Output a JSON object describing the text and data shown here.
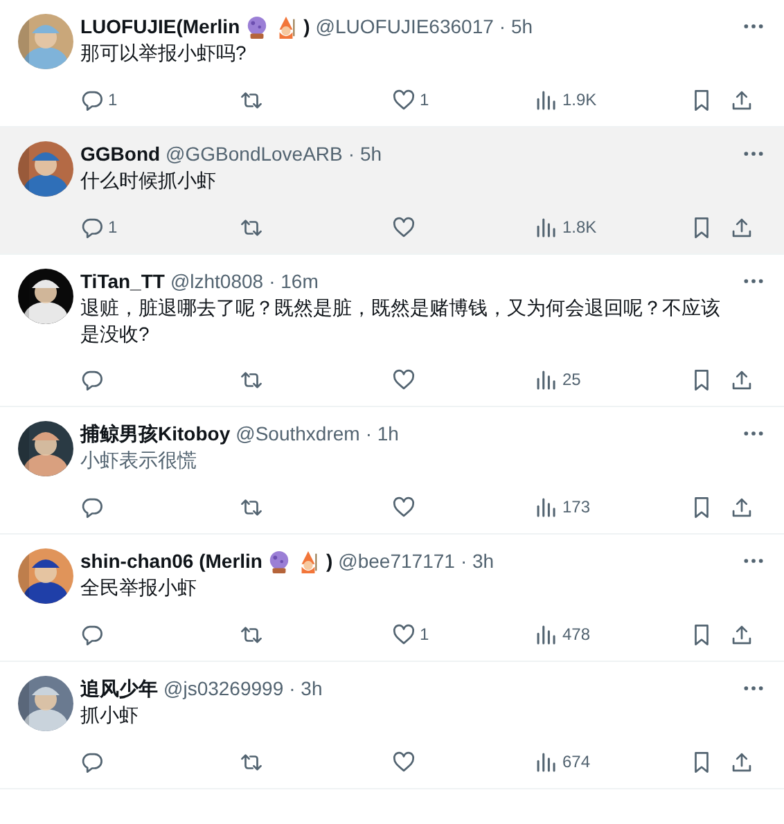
{
  "replies": [
    {
      "name": "LUOFUJIE(Merlin",
      "emoji_badges": true,
      "name_end": ")",
      "handle": "@LUOFUJIE636017",
      "time": "· 5h",
      "text": "那可以举报小虾吗?",
      "highlighted": false,
      "dimmed": false,
      "reply_count": "1",
      "like_count": "1",
      "views": "1.9K"
    },
    {
      "name": "GGBond",
      "handle": "@GGBondLoveARB",
      "time": "· 5h",
      "text": "什么时候抓小虾",
      "highlighted": true,
      "dimmed": false,
      "reply_count": "1",
      "views": "1.8K"
    },
    {
      "name": "TiTan_TT",
      "handle": "@lzht0808",
      "time": "· 16m",
      "text": "退赃，脏退哪去了呢？既然是脏，既然是赌博钱，又为何会退回呢？不应该是没收?",
      "highlighted": false,
      "dimmed": false,
      "views": "25"
    },
    {
      "name": "捕鲸男孩Kitoboy",
      "handle": "@Southxdrem",
      "time": "· 1h",
      "text": "小虾表示很慌",
      "highlighted": false,
      "dimmed": true,
      "views": "173"
    },
    {
      "name": "shin-chan06 (Merlin",
      "emoji_badges": true,
      "name_end": ")",
      "handle": "@bee717171",
      "time": "· 3h",
      "text": "全民举报小虾",
      "highlighted": false,
      "dimmed": false,
      "like_count": "1",
      "views": "478"
    },
    {
      "name": "追风少年",
      "handle": "@js03269999",
      "time": "· 3h",
      "text": "抓小虾",
      "highlighted": false,
      "dimmed": false,
      "views": "674"
    }
  ]
}
